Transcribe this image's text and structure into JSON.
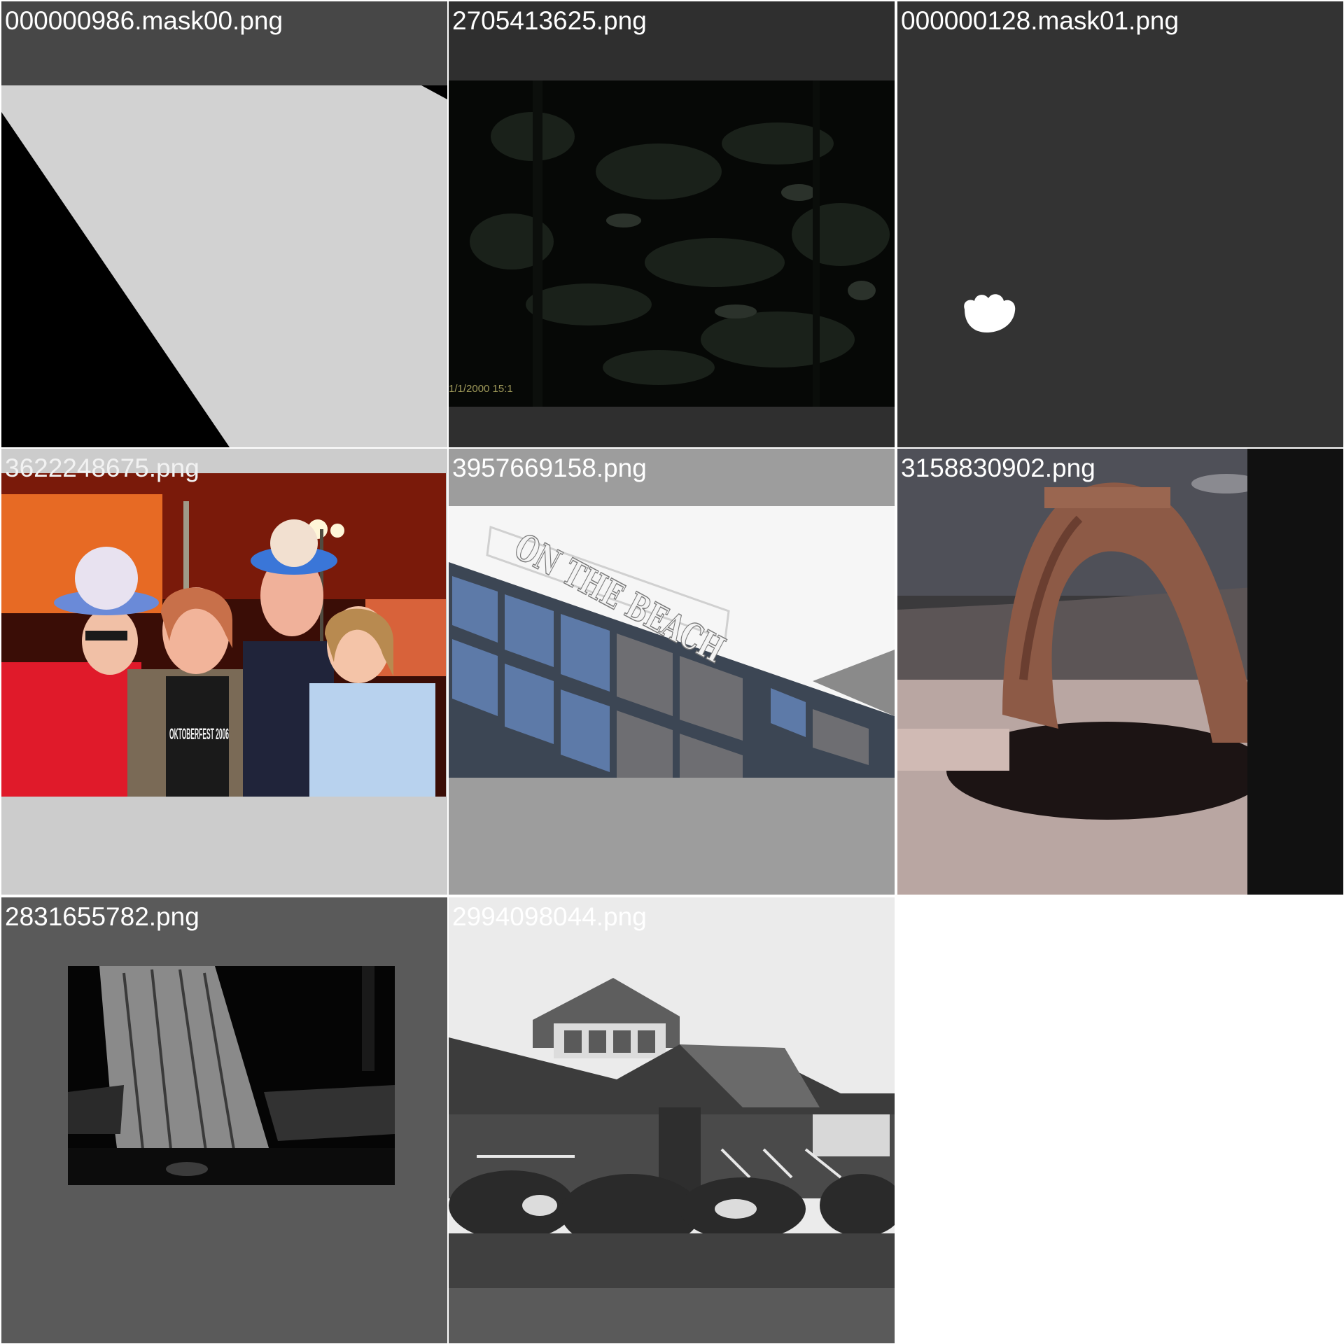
{
  "tiles": [
    {
      "filename": "000000986.mask00.png",
      "background": "#474747",
      "label_color": "#ffffff"
    },
    {
      "filename": "2705413625.png",
      "background": "#2f2f2f",
      "label_color": "#ffffff"
    },
    {
      "filename": "000000128.mask01.png",
      "background": "#333333",
      "label_color": "#ffffff"
    },
    {
      "filename": "3622248675.png",
      "background": "#cccccc",
      "label_color": "#f2f2f2"
    },
    {
      "filename": "3957669158.png",
      "background": "#9d9d9d",
      "label_color": "#ffffff"
    },
    {
      "filename": "3158830902.png",
      "background": "#111111",
      "label_color": "#ffffff"
    },
    {
      "filename": "2831655782.png",
      "background": "#5a5a5a",
      "label_color": "#ffffff"
    },
    {
      "filename": "2994098044.png",
      "background": "#ebebeb",
      "label_color": "#ffffff"
    }
  ],
  "photos": {
    "camera_timestamp": "1/1/2000 15:1",
    "sign_text": "ON THE BEACH",
    "shirt_text": "OKTOBERFEST 2006"
  },
  "colors": {
    "page_background": "#ffffff"
  }
}
